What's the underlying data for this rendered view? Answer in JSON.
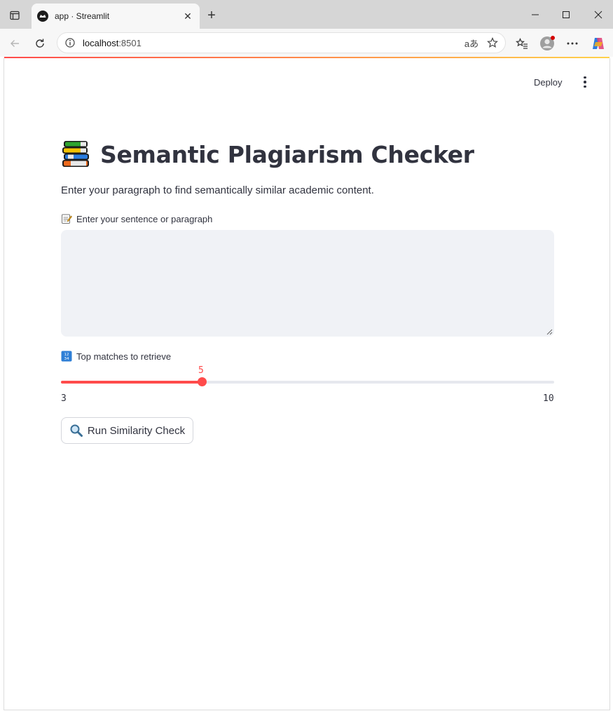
{
  "browser": {
    "tab_title": "app · Streamlit",
    "url_host": "localhost",
    "url_port": ":8501",
    "icons": [
      "tab-actions-icon",
      "streamlit-favicon-icon",
      "close-icon",
      "new-tab-icon",
      "minimize-icon",
      "maximize-icon",
      "window-close-icon",
      "back-icon",
      "refresh-icon",
      "site-info-icon",
      "read-aloud-icon",
      "favorite-icon",
      "favorites-icon",
      "profile-icon",
      "more-icon",
      "copilot-icon"
    ]
  },
  "app": {
    "deploy_label": "Deploy",
    "title": "Semantic Plagiarism Checker",
    "subtitle": "Enter your paragraph to find semantically similar academic content.",
    "textarea_label": "Enter your sentence or paragraph",
    "textarea_value": "",
    "slider_label": "Top matches to retrieve",
    "slider": {
      "min": "3",
      "max": "10",
      "value": "5",
      "min_num": 3,
      "max_num": 10,
      "value_num": 5
    },
    "run_button_label": "Run Similarity Check",
    "accent_color": "#ff4b4b"
  }
}
